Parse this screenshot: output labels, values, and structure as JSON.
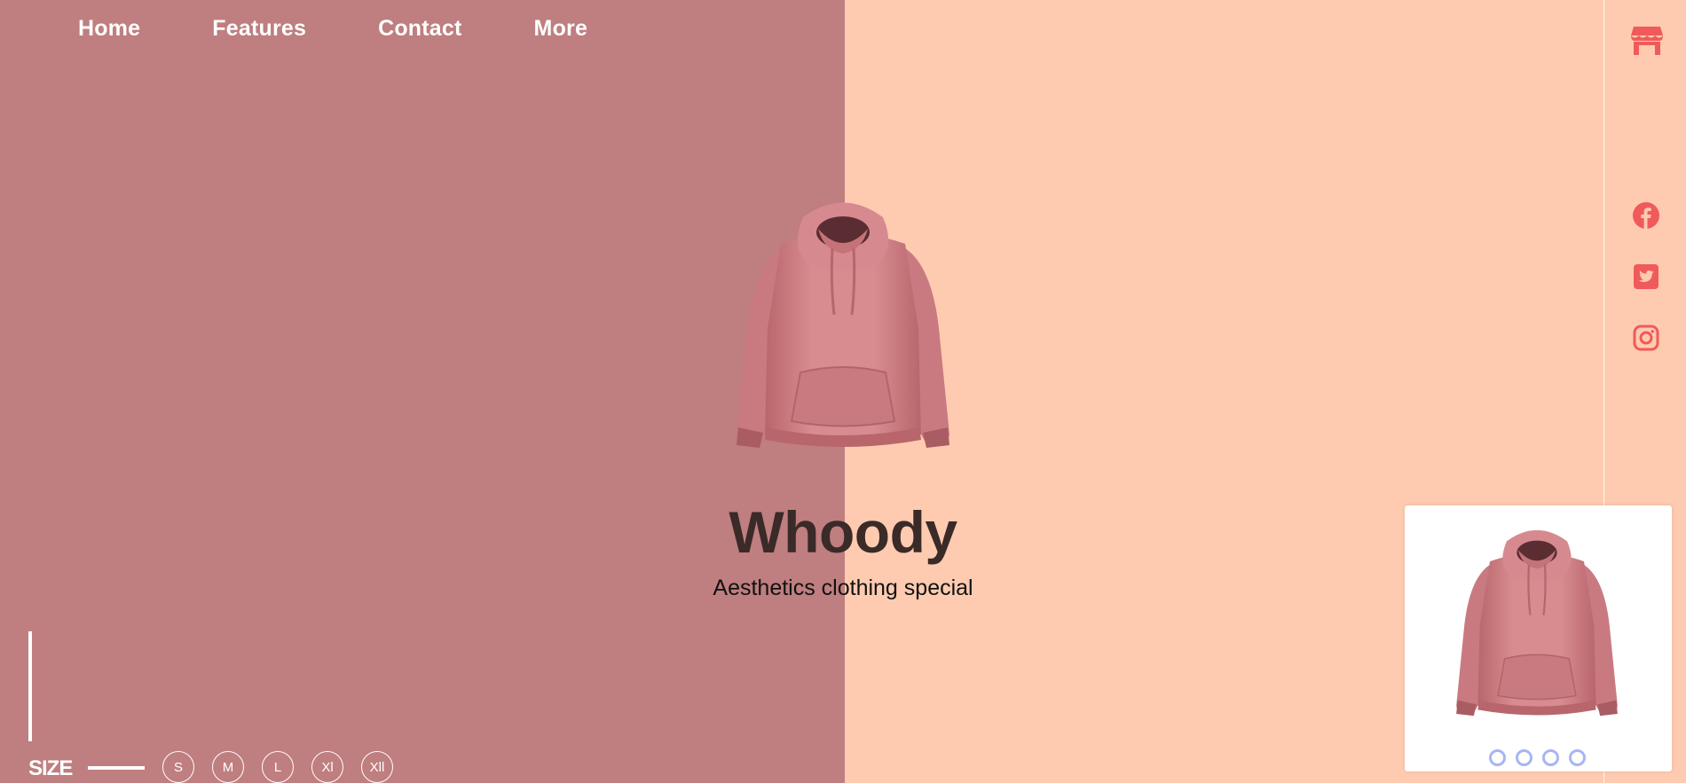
{
  "nav": {
    "items": [
      "Home",
      "Features",
      "Contact",
      "More"
    ]
  },
  "product": {
    "title": "Whoody",
    "subtitle": "Aesthetics clothing special"
  },
  "size": {
    "label": "SIZE",
    "options": [
      "S",
      "M",
      "L",
      "Xl",
      "Xll"
    ]
  },
  "icons": {
    "store": "store-icon",
    "social": [
      "facebook-icon",
      "twitter-icon",
      "instagram-icon"
    ]
  },
  "carousel": {
    "dot_count": 4
  },
  "colors": {
    "left_bg": "#bf7e7f",
    "right_bg": "#ffcbb0",
    "accent": "#f05a5a",
    "hoodie": "#d98b8e",
    "dots": "#a8b4f4"
  }
}
